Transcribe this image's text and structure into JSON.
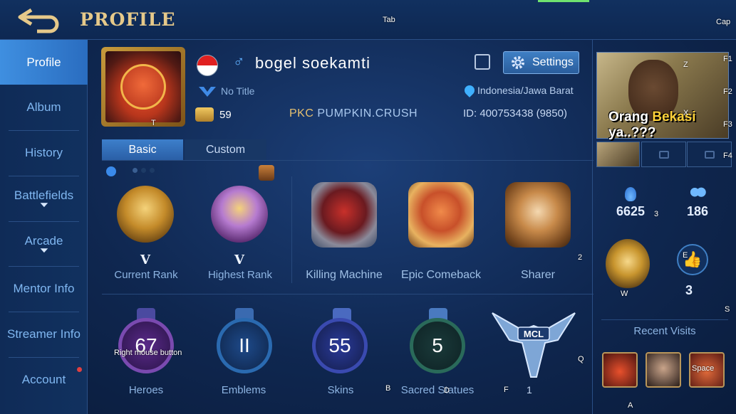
{
  "header": {
    "title": "PROFILE"
  },
  "key_hints": {
    "tab": "Tab",
    "cap": "Cap",
    "t": "T",
    "f1": "F1",
    "f2": "F2",
    "f3": "F3",
    "f4": "F4",
    "z": "Z",
    "x": "X",
    "two": "2",
    "three": "3",
    "e": "E",
    "w": "W",
    "s": "S",
    "q": "Q",
    "b": "B",
    "d": "D",
    "f": "F",
    "a": "A",
    "rmb": "Right mouse button",
    "space": "Space"
  },
  "sidebar": {
    "items": [
      {
        "label": "Profile"
      },
      {
        "label": "Album"
      },
      {
        "label": "History"
      },
      {
        "label": "Battlefields"
      },
      {
        "label": "Arcade"
      },
      {
        "label": "Mentor Info"
      },
      {
        "label": "Streamer Info"
      },
      {
        "label": "Account"
      }
    ]
  },
  "profile": {
    "username": "bogel soekamti",
    "gender_symbol": "♂",
    "title": "No Title",
    "level": "59",
    "squad_tag": "PKC",
    "squad_name": "PUMPKIN.CRUSH",
    "location": "Indonesia/Jawa Barat",
    "id": "ID:  400753438 (9850)",
    "settings_label": "Settings"
  },
  "tabs": [
    {
      "label": "Basic"
    },
    {
      "label": "Custom"
    }
  ],
  "ranks": [
    {
      "roman": "V",
      "label": "Current Rank"
    },
    {
      "roman": "V",
      "label": "Highest Rank"
    }
  ],
  "achievements": [
    {
      "label": "Killing Machine"
    },
    {
      "label": "Epic Comeback"
    },
    {
      "label": "Sharer"
    }
  ],
  "stats": [
    {
      "value": "67",
      "label": "Heroes"
    },
    {
      "value": "II",
      "label": "Emblems"
    },
    {
      "value": "55",
      "label": "Skins"
    },
    {
      "value": "5",
      "label": "Sacred Statues"
    }
  ],
  "mcl": {
    "text": "MCL",
    "count": "1"
  },
  "right_panel": {
    "photo_caption_pre": "Orang ",
    "photo_caption_hl": "Bekasi",
    "photo_caption_post": " ya..???",
    "popularity": "6625",
    "followers": "186",
    "likes": "3",
    "recent_visits_title": "Recent Visits"
  },
  "colors": {
    "accent": "#3d7fcb",
    "gold": "#e6c98a",
    "bg": "#0f2750"
  }
}
